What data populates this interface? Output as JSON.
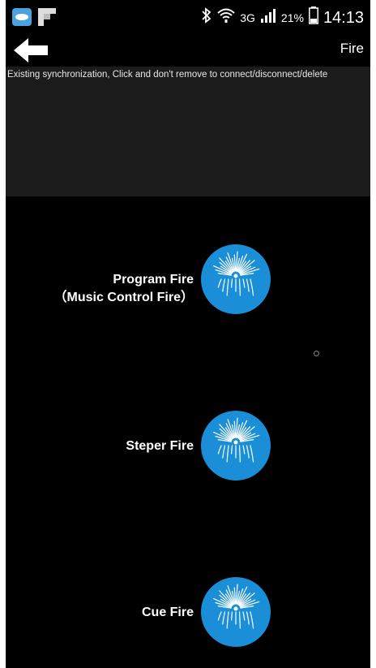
{
  "status_bar": {
    "network": "3G",
    "battery": "21%",
    "time": "14:13",
    "icons": [
      "app-icon",
      "flipboard-icon",
      "bluetooth-icon",
      "wifi-icon",
      "signal-icon",
      "battery-icon"
    ]
  },
  "app_bar": {
    "back_icon": "back-arrow-icon",
    "title": "Fire"
  },
  "sync": {
    "message": "Existing synchronization, Click and don't remove to connect/disconnect/delete"
  },
  "fire_options": [
    {
      "line1": "Program Fire",
      "line2": "（Music Control Fire）",
      "icon": "firework-icon"
    },
    {
      "line1": "Steper  Fire",
      "line2": "",
      "icon": "firework-icon"
    },
    {
      "line1": "Cue  Fire",
      "line2": "",
      "icon": "firework-icon"
    }
  ],
  "colors": {
    "background": "#000000",
    "sync_area": "#1b1b1b",
    "button_blue": "#1a8fd8"
  }
}
